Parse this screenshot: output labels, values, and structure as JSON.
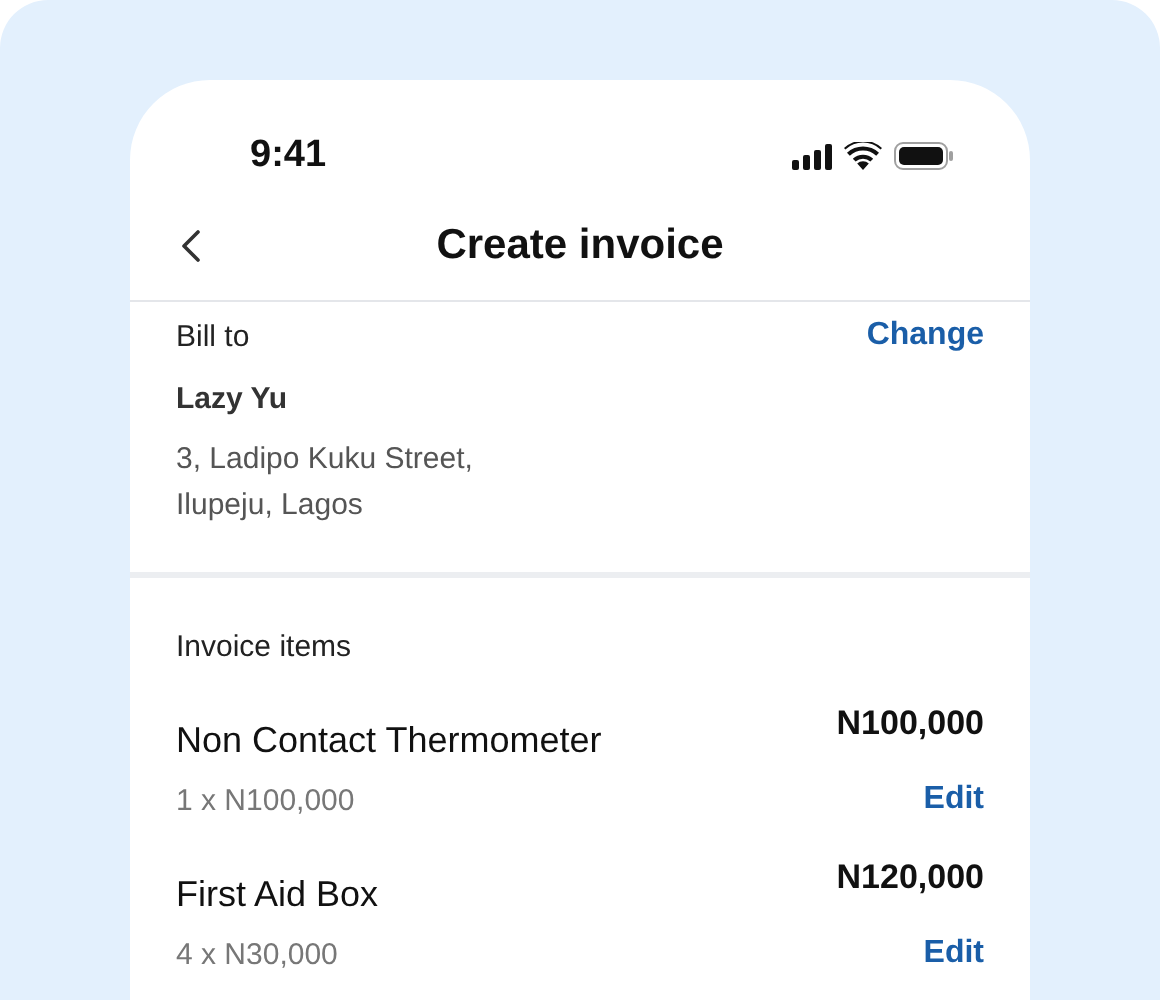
{
  "status_bar": {
    "time": "9:41"
  },
  "header": {
    "title": "Create invoice"
  },
  "bill_to": {
    "label": "Bill to",
    "action": "Change",
    "name": "Lazy Yu",
    "address_lines": [
      "3, Ladipo Kuku Street,",
      "Ilupeju, Lagos"
    ]
  },
  "invoice_items": {
    "label": "Invoice items",
    "items": [
      {
        "name": "Non Contact Thermometer",
        "amount": "N100,000",
        "quantity": "1 x N100,000",
        "action": "Edit"
      },
      {
        "name": "First Aid Box",
        "amount": "N120,000",
        "quantity": "4 x N30,000",
        "action": "Edit"
      }
    ]
  }
}
